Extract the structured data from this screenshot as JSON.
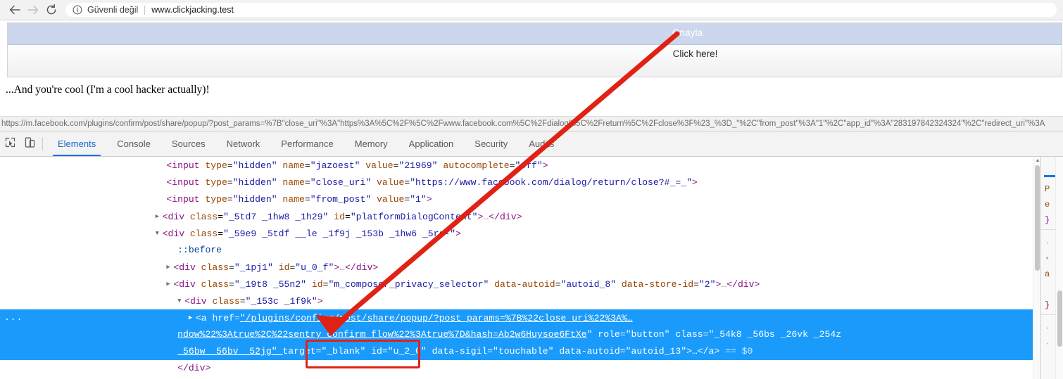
{
  "browser": {
    "back_icon": "arrow-left-icon",
    "forward_icon": "arrow-right-icon",
    "reload_icon": "reload-icon",
    "info_icon": "info-circle-icon",
    "security_label": "Güvenli değil",
    "url": "www.clickjacking.test"
  },
  "page": {
    "iframe": {
      "confirm_button_label": "Onayla",
      "overlay_label": "Click here!",
      "band_color": "#ccd6ec"
    },
    "body_text": "...And you're cool (I'm a cool hacker actually)!",
    "status_url": "https://m.facebook.com/plugins/confirm/post/share/popup/?post_params=%7B\"close_uri\"%3A\"https%3A%5C%2F%5C%2Fwww.facebook.com%5C%2Fdialog%5C%2Freturn%5C%2Fclose%3F%23_%3D_\"%2C\"from_post\"%3A\"1\"%2C\"app_id\"%3A\"283197842324324\"%2C\"redirect_uri\"%3A"
  },
  "devtools": {
    "inspect_icon": "cursor-inspect-icon",
    "device_icon": "device-toggle-icon",
    "tabs": [
      {
        "label": "Elements",
        "active": true
      },
      {
        "label": "Console",
        "active": false
      },
      {
        "label": "Sources",
        "active": false
      },
      {
        "label": "Network",
        "active": false
      },
      {
        "label": "Performance",
        "active": false
      },
      {
        "label": "Memory",
        "active": false
      },
      {
        "label": "Application",
        "active": false
      },
      {
        "label": "Security",
        "active": false
      },
      {
        "label": "Audits",
        "active": false
      }
    ],
    "selected_marker": "...",
    "dom_lines": [
      {
        "indent": 30,
        "twisty": "",
        "segments": [
          {
            "c": "punc",
            "t": "<"
          },
          {
            "c": "tag",
            "t": "input"
          },
          {
            "c": "attr",
            "t": " type"
          },
          {
            "c": "eq",
            "t": "="
          },
          {
            "c": "val",
            "t": "\"hidden\""
          },
          {
            "c": "attr",
            "t": " name"
          },
          {
            "c": "eq",
            "t": "="
          },
          {
            "c": "val",
            "t": "\"jazoest\""
          },
          {
            "c": "attr",
            "t": " value"
          },
          {
            "c": "eq",
            "t": "="
          },
          {
            "c": "val",
            "t": "\"21969\""
          },
          {
            "c": "attr",
            "t": " autocomplete"
          },
          {
            "c": "eq",
            "t": "="
          },
          {
            "c": "val",
            "t": "\"off\""
          },
          {
            "c": "punc",
            "t": ">"
          }
        ]
      },
      {
        "indent": 30,
        "twisty": "",
        "segments": [
          {
            "c": "punc",
            "t": "<"
          },
          {
            "c": "tag",
            "t": "input"
          },
          {
            "c": "attr",
            "t": " type"
          },
          {
            "c": "eq",
            "t": "="
          },
          {
            "c": "val",
            "t": "\"hidden\""
          },
          {
            "c": "attr",
            "t": " name"
          },
          {
            "c": "eq",
            "t": "="
          },
          {
            "c": "val",
            "t": "\"close_uri\""
          },
          {
            "c": "attr",
            "t": " value"
          },
          {
            "c": "eq",
            "t": "="
          },
          {
            "c": "val",
            "t": "\"https://www.facebook.com/dialog/return/close?#_=_\""
          },
          {
            "c": "punc",
            "t": ">"
          }
        ]
      },
      {
        "indent": 30,
        "twisty": "",
        "segments": [
          {
            "c": "punc",
            "t": "<"
          },
          {
            "c": "tag",
            "t": "input"
          },
          {
            "c": "attr",
            "t": " type"
          },
          {
            "c": "eq",
            "t": "="
          },
          {
            "c": "val",
            "t": "\"hidden\""
          },
          {
            "c": "attr",
            "t": " name"
          },
          {
            "c": "eq",
            "t": "="
          },
          {
            "c": "val",
            "t": "\"from_post\""
          },
          {
            "c": "attr",
            "t": " value"
          },
          {
            "c": "eq",
            "t": "="
          },
          {
            "c": "val",
            "t": "\"1\""
          },
          {
            "c": "punc",
            "t": ">"
          }
        ]
      },
      {
        "indent": 28,
        "twisty": "▶",
        "segments": [
          {
            "c": "punc",
            "t": "<"
          },
          {
            "c": "tag",
            "t": "div"
          },
          {
            "c": "attr",
            "t": " class"
          },
          {
            "c": "eq",
            "t": "="
          },
          {
            "c": "val",
            "t": "\"_5td7 _1hw8 _1h29\""
          },
          {
            "c": "attr",
            "t": " id"
          },
          {
            "c": "eq",
            "t": "="
          },
          {
            "c": "val",
            "t": "\"platformDialogContent\""
          },
          {
            "c": "punc",
            "t": ">"
          },
          {
            "c": "ellipsis-txt",
            "t": "…"
          },
          {
            "c": "punc",
            "t": "</"
          },
          {
            "c": "tag",
            "t": "div"
          },
          {
            "c": "punc",
            "t": ">"
          }
        ]
      },
      {
        "indent": 28,
        "twisty": "▼",
        "segments": [
          {
            "c": "punc",
            "t": "<"
          },
          {
            "c": "tag",
            "t": "div"
          },
          {
            "c": "attr",
            "t": " class"
          },
          {
            "c": "eq",
            "t": "="
          },
          {
            "c": "val",
            "t": "\"_59e9 _5tdf __le _1f9j _153b _1hw6 _5rs-\""
          },
          {
            "c": "punc",
            "t": ">"
          }
        ]
      },
      {
        "indent": 32,
        "twisty": "",
        "segments": [
          {
            "c": "pseudo",
            "t": "::before"
          }
        ]
      },
      {
        "indent": 30,
        "twisty": "▶",
        "segments": [
          {
            "c": "punc",
            "t": "<"
          },
          {
            "c": "tag",
            "t": "div"
          },
          {
            "c": "attr",
            "t": " class"
          },
          {
            "c": "eq",
            "t": "="
          },
          {
            "c": "val",
            "t": "\"_1pj1\""
          },
          {
            "c": "attr",
            "t": " id"
          },
          {
            "c": "eq",
            "t": "="
          },
          {
            "c": "val",
            "t": "\"u_0_f\""
          },
          {
            "c": "punc",
            "t": ">"
          },
          {
            "c": "ellipsis-txt",
            "t": "…"
          },
          {
            "c": "punc",
            "t": "</"
          },
          {
            "c": "tag",
            "t": "div"
          },
          {
            "c": "punc",
            "t": ">"
          }
        ]
      },
      {
        "indent": 30,
        "twisty": "▶",
        "segments": [
          {
            "c": "punc",
            "t": "<"
          },
          {
            "c": "tag",
            "t": "div"
          },
          {
            "c": "attr",
            "t": " class"
          },
          {
            "c": "eq",
            "t": "="
          },
          {
            "c": "val",
            "t": "\"_19t8 _55n2\""
          },
          {
            "c": "attr",
            "t": " id"
          },
          {
            "c": "eq",
            "t": "="
          },
          {
            "c": "val",
            "t": "\"m_composer_privacy_selector\""
          },
          {
            "c": "attr",
            "t": " data-autoid"
          },
          {
            "c": "eq",
            "t": "="
          },
          {
            "c": "val",
            "t": "\"autoid_8\""
          },
          {
            "c": "attr",
            "t": " data-store-id"
          },
          {
            "c": "eq",
            "t": "="
          },
          {
            "c": "val",
            "t": "\"2\""
          },
          {
            "c": "punc",
            "t": ">"
          },
          {
            "c": "ellipsis-txt",
            "t": "…"
          },
          {
            "c": "punc",
            "t": "</"
          },
          {
            "c": "tag",
            "t": "div"
          },
          {
            "c": "punc",
            "t": ">"
          }
        ]
      },
      {
        "indent": 32,
        "twisty": "▼",
        "segments": [
          {
            "c": "punc",
            "t": "<"
          },
          {
            "c": "tag",
            "t": "div"
          },
          {
            "c": "attr",
            "t": " class"
          },
          {
            "c": "eq",
            "t": "="
          },
          {
            "c": "val",
            "t": "\"_153c _1f9k\""
          },
          {
            "c": "punc",
            "t": ">"
          }
        ]
      }
    ],
    "selected_node": {
      "line1": {
        "indent": 34,
        "twisty": "▶",
        "open": "<a ",
        "attr": "href",
        "value_link": "\"/plugins/confirm/post/share/popup/?post_params=%7B%22close_uri%22%3A%…"
      },
      "line2": "ndow%22%3Atrue%2C%22sentry_confirm_flow%22%3Atrue%7D&hash=Ab2w6Huysoe6FtXe\" role=\"button\" class=\"_54k8 _56bs _26vk _254z",
      "line3_a": "_56bw _56bv _52jg\" ",
      "line3_highlight": "target=\"_blank\"",
      "line3_b": " id=\"u_2_0\" data-sigil=\"touchable\" data-autoid=\"autoid_13\">…</a>",
      "line3_tail": " == $0"
    },
    "closing_line": {
      "indent": 32,
      "segments": [
        {
          "c": "punc",
          "t": "</"
        },
        {
          "c": "tag",
          "t": "div"
        },
        {
          "c": "punc",
          "t": ">"
        }
      ]
    },
    "styles_pane_fragments": [
      "P",
      "e",
      "}",
      "a",
      "}"
    ]
  },
  "annotations": {
    "arrow_color": "#e02215",
    "highlight_box_color": "#e02215",
    "arrow_label": "red-arrow-annotation",
    "box_label": "target-blank-highlight-box"
  }
}
